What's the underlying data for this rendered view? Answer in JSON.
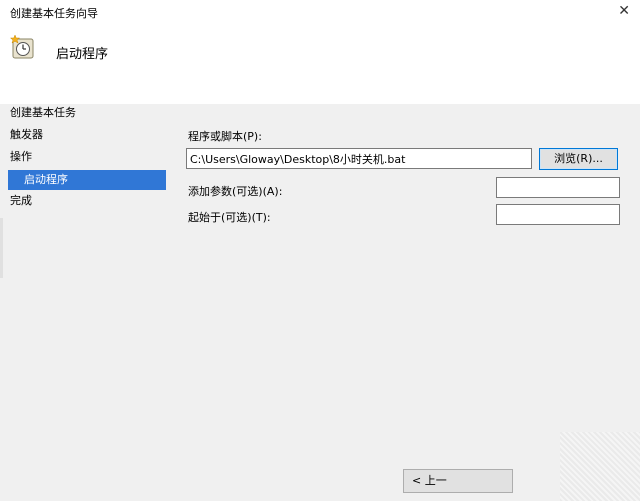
{
  "window": {
    "title": "创建基本任务向导",
    "close_glyph": "✕"
  },
  "header": {
    "step_title": "启动程序",
    "icon": "task-scheduler-clock-icon"
  },
  "nav": {
    "items": [
      {
        "label": "创建基本任务"
      },
      {
        "label": "触发器"
      },
      {
        "label": "操作"
      },
      {
        "label": "启动程序",
        "selected": true
      },
      {
        "label": "完成"
      }
    ]
  },
  "form": {
    "program_label": "程序或脚本(P):",
    "program_value": "C:\\Users\\Gloway\\Desktop\\8小时关机.bat",
    "browse_label": "浏览(R)...",
    "args_label": "添加参数(可选)(A):",
    "args_value": "",
    "startin_label": "起始于(可选)(T):",
    "startin_value": ""
  },
  "footer": {
    "back_label": "< 上一"
  },
  "colors": {
    "selected_bg": "#3077d6",
    "window_bg": "#f0f0f0",
    "header_bg": "#ffffff"
  }
}
